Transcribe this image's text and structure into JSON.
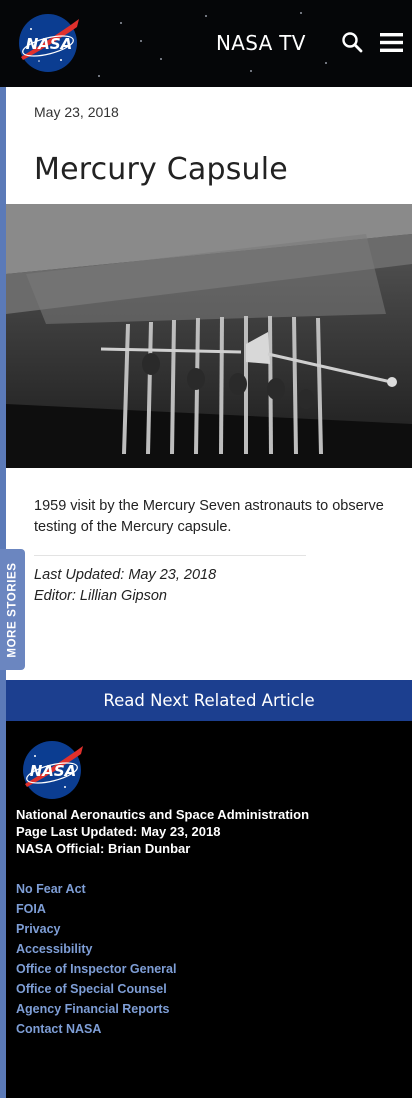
{
  "header": {
    "logo_text": "NASA",
    "nav_title": "NASA TV"
  },
  "article": {
    "date": "May 23, 2018",
    "title": "Mercury Capsule",
    "caption": "1959 visit by the Mercury Seven astronauts to observe testing of the Mercury capsule.",
    "last_updated": "Last Updated: May 23, 2018",
    "editor": "Editor: Lillian Gipson"
  },
  "sidebar": {
    "more_stories": "MORE STORIES"
  },
  "read_next": {
    "label": "Read Next Related Article"
  },
  "footer": {
    "logo_text": "NASA",
    "org": "National Aeronautics and Space Administration",
    "page_updated": "Page Last Updated: May 23, 2018",
    "official": "NASA Official: Brian Dunbar",
    "links": [
      "No Fear Act",
      "FOIA",
      "Privacy",
      "Accessibility",
      "Office of Inspector General",
      "Office of Special Counsel",
      "Agency Financial Reports",
      "Contact NASA"
    ]
  },
  "colors": {
    "brand_blue": "#1c3f8f",
    "rail_blue": "#5b7ab8",
    "link_blue": "#7e9ed6",
    "nasa_red": "#e0302c"
  }
}
